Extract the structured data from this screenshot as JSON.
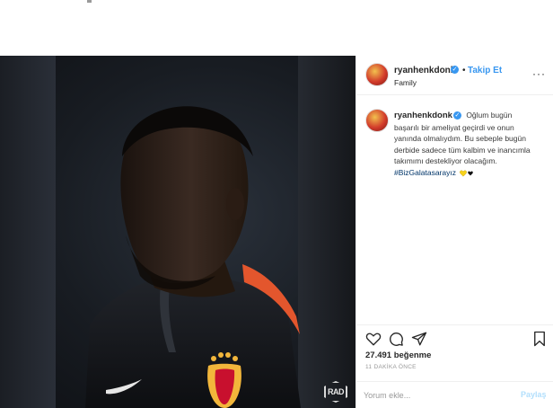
{
  "post": {
    "username": "ryanhenkdonk",
    "follow_label": "Takip Et",
    "separator": "•",
    "location": "Family",
    "verified_mark": "✓",
    "more_label": "···",
    "photo_badge": "RAD"
  },
  "caption": {
    "username": "ryanhenkdonk",
    "text": "Oğlum bugün başarılı bir ameliyat geçirdi ve onun yanında olmalıydım. Bu sebeple bugün derbide sadece tüm kalbim ve inancımla takımımı destekliyor olacağım.",
    "hashtag": "#BizGalatasarayız",
    "hearts": [
      "yellow-heart-icon",
      "black-heart-icon"
    ]
  },
  "actions": {
    "icons": [
      "heart-icon",
      "comment-icon",
      "share-icon",
      "bookmark-icon"
    ],
    "likes": "27.491 beğenme",
    "time_ago": "11 DAKİKA ÖNCE"
  },
  "comment": {
    "placeholder": "Yorum ekle...",
    "submit_label": "Paylaş"
  },
  "colors": {
    "accent": "#3897f0",
    "heart_yellow": "#f7d21b",
    "jersey_orange": "#e3562d"
  }
}
